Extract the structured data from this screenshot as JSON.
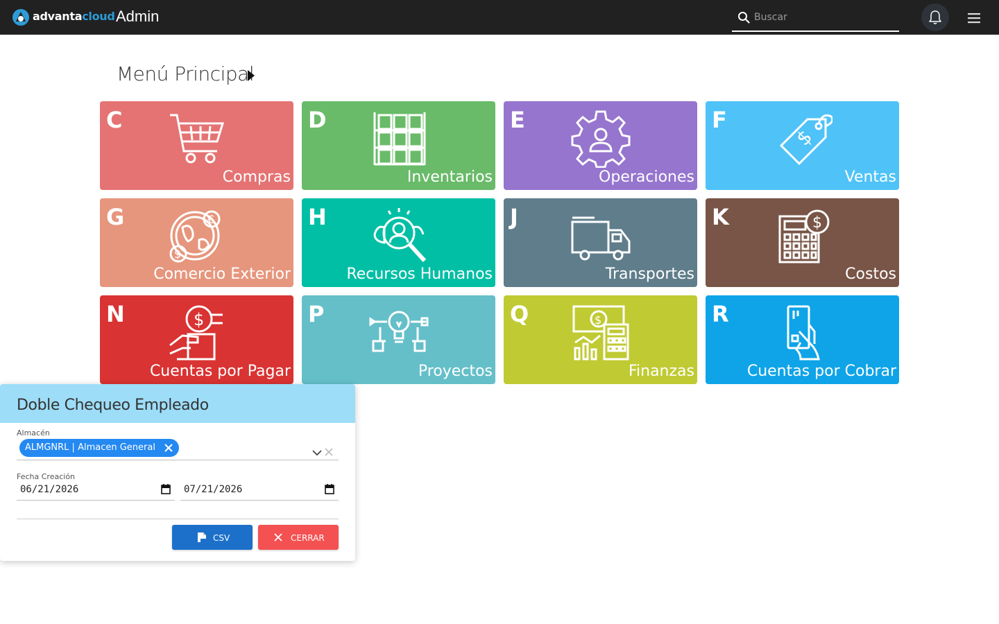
{
  "topbar": {
    "brand_part1": "advanta",
    "brand_part2": "cloud",
    "app_title": "Admin",
    "search_placeholder": "Buscar",
    "icons": [
      "logo-icon",
      "search-icon",
      "bell-icon",
      "menu-icon"
    ]
  },
  "main": {
    "heading": "Menú Principal",
    "tiles": [
      {
        "letter": "C",
        "label": "Compras",
        "color": "#e57373",
        "icon": "shopping-cart-icon"
      },
      {
        "letter": "D",
        "label": "Inventarios",
        "color": "#69bb6a",
        "icon": "inventory-boxes-icon"
      },
      {
        "letter": "E",
        "label": "Operaciones",
        "color": "#9575cd",
        "icon": "gear-user-icon"
      },
      {
        "letter": "F",
        "label": "Ventas",
        "color": "#4fc3f7",
        "icon": "price-tag-icon"
      },
      {
        "letter": "G",
        "label": "Comercio Exterior",
        "color": "#e5967c",
        "icon": "globe-currency-icon"
      },
      {
        "letter": "H",
        "label": "Recursos Humanos",
        "color": "#00bfa5",
        "icon": "person-search-icon"
      },
      {
        "letter": "J",
        "label": "Transportes",
        "color": "#607d8b",
        "icon": "truck-icon"
      },
      {
        "letter": "K",
        "label": "Costos",
        "color": "#795548",
        "icon": "calculator-icon"
      },
      {
        "letter": "N",
        "label": "Cuentas por Pagar",
        "color": "#d93333",
        "icon": "hand-coin-icon"
      },
      {
        "letter": "P",
        "label": "Proyectos",
        "color": "#64bfc9",
        "icon": "lightbulb-project-icon"
      },
      {
        "letter": "Q",
        "label": "Finanzas",
        "color": "#c0ca33",
        "icon": "finance-calculator-icon"
      },
      {
        "letter": "R",
        "label": "Cuentas por Cobrar",
        "color": "#0ea4e7",
        "icon": "card-payment-icon"
      }
    ]
  },
  "dialog": {
    "title": "Doble Chequeo Empleado",
    "warehouse_label": "Almacén",
    "warehouse_chip": "ALMGNRL | Almacen General",
    "date_label": "Fecha Creación",
    "date_from": "06/21/2026",
    "date_to": "07/21/2026",
    "csv_label": "CSV",
    "close_label": "CERRAR"
  }
}
